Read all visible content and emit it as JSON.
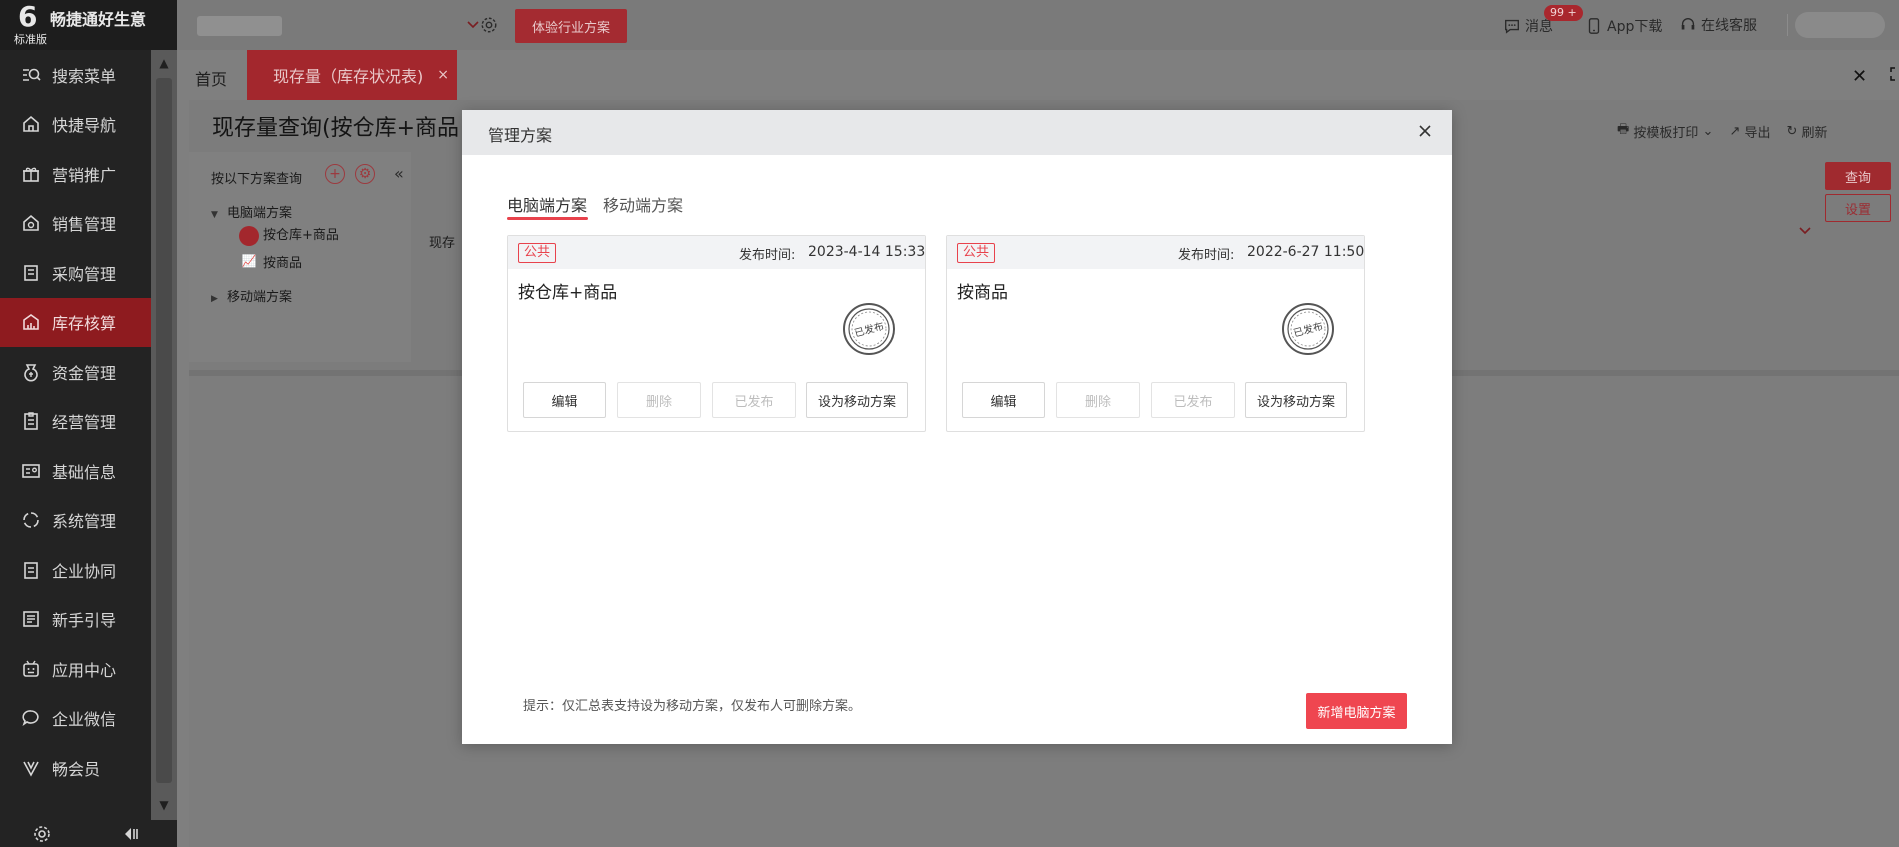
{
  "app": {
    "name": "畅捷通好生意",
    "edition": "标准版",
    "industry_button": "体验行业方案"
  },
  "topbar": {
    "message_label": "消息",
    "message_badge": "99 +",
    "app_download": "App下载",
    "online_service": "在线客服"
  },
  "sidebar": {
    "items": [
      {
        "label": "搜索菜单",
        "icon": "search-menu-icon"
      },
      {
        "label": "快捷导航",
        "icon": "home-icon"
      },
      {
        "label": "营销推广",
        "icon": "gift-icon"
      },
      {
        "label": "销售管理",
        "icon": "sales-icon"
      },
      {
        "label": "采购管理",
        "icon": "cart-icon"
      },
      {
        "label": "库存核算",
        "icon": "inventory-icon",
        "active": true
      },
      {
        "label": "资金管理",
        "icon": "money-icon"
      },
      {
        "label": "经营管理",
        "icon": "clipboard-icon"
      },
      {
        "label": "基础信息",
        "icon": "id-card-icon"
      },
      {
        "label": "系统管理",
        "icon": "cycle-icon"
      },
      {
        "label": "企业协同",
        "icon": "doc-icon"
      },
      {
        "label": "新手引导",
        "icon": "guide-icon"
      },
      {
        "label": "应用中心",
        "icon": "robot-icon"
      },
      {
        "label": "企业微信",
        "icon": "chat-icon"
      },
      {
        "label": "畅会员",
        "icon": "vip-icon"
      }
    ]
  },
  "tabs": {
    "home": "首页",
    "current": "现存量（库存状况表)",
    "current_close": "×",
    "close_all": "✕"
  },
  "page": {
    "title": "现存量查询(按仓库+商品",
    "tools": [
      "按模板打印",
      "导出",
      "刷新"
    ],
    "scheme_head": "按以下方案查询",
    "tree": {
      "pc_group": "电脑端方案",
      "item_1": "按仓库+商品",
      "item_2": "按商品",
      "mobile_group": "移动端方案"
    },
    "main_label": "现存",
    "query_button": "查询",
    "setting_button": "设置"
  },
  "modal": {
    "title": "管理方案",
    "tabs": [
      "电脑端方案",
      "移动端方案"
    ],
    "active_tab": 0,
    "cards": [
      {
        "tag": "公共",
        "time_label": "发布时间:",
        "time_value": "2023-4-14 15:33",
        "name": "按仓库+商品",
        "stamp_text": "已发布",
        "buttons": {
          "edit": "编辑",
          "delete": "删除",
          "published": "已发布",
          "set_mobile": "设为移动方案"
        }
      },
      {
        "tag": "公共",
        "time_label": "发布时间:",
        "time_value": "2022-6-27 11:50",
        "name": "按商品",
        "stamp_text": "已发布",
        "buttons": {
          "edit": "编辑",
          "delete": "删除",
          "published": "已发布",
          "set_mobile": "设为移动方案"
        }
      }
    ],
    "tip": "提示：仅汇总表支持设为移动方案，仅发布人可删除方案。",
    "add_button": "新增电脑方案"
  },
  "colors": {
    "accent": "#e8424c",
    "sidebar_bg": "#232323",
    "header_bg": "#e7e8ea"
  }
}
